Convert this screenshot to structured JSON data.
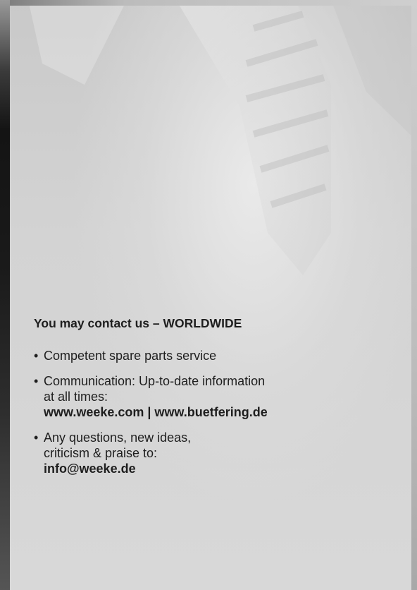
{
  "contact": {
    "heading": "You may contact us – WORLDWIDE",
    "items": [
      {
        "bullet": "•",
        "line1": "Competent spare parts service"
      },
      {
        "bullet": "•",
        "line1": "Communication: Up-to-date information",
        "line2": "at all times:",
        "websites": "www.weeke.com | www.buetfering.de"
      },
      {
        "bullet": "•",
        "line1": "Any questions, new ideas,",
        "line2": "criticism & praise to:",
        "email": "info@weeke.de"
      }
    ]
  },
  "colors": {
    "text": "#1e1e1e",
    "background": "#d9d9d9"
  }
}
